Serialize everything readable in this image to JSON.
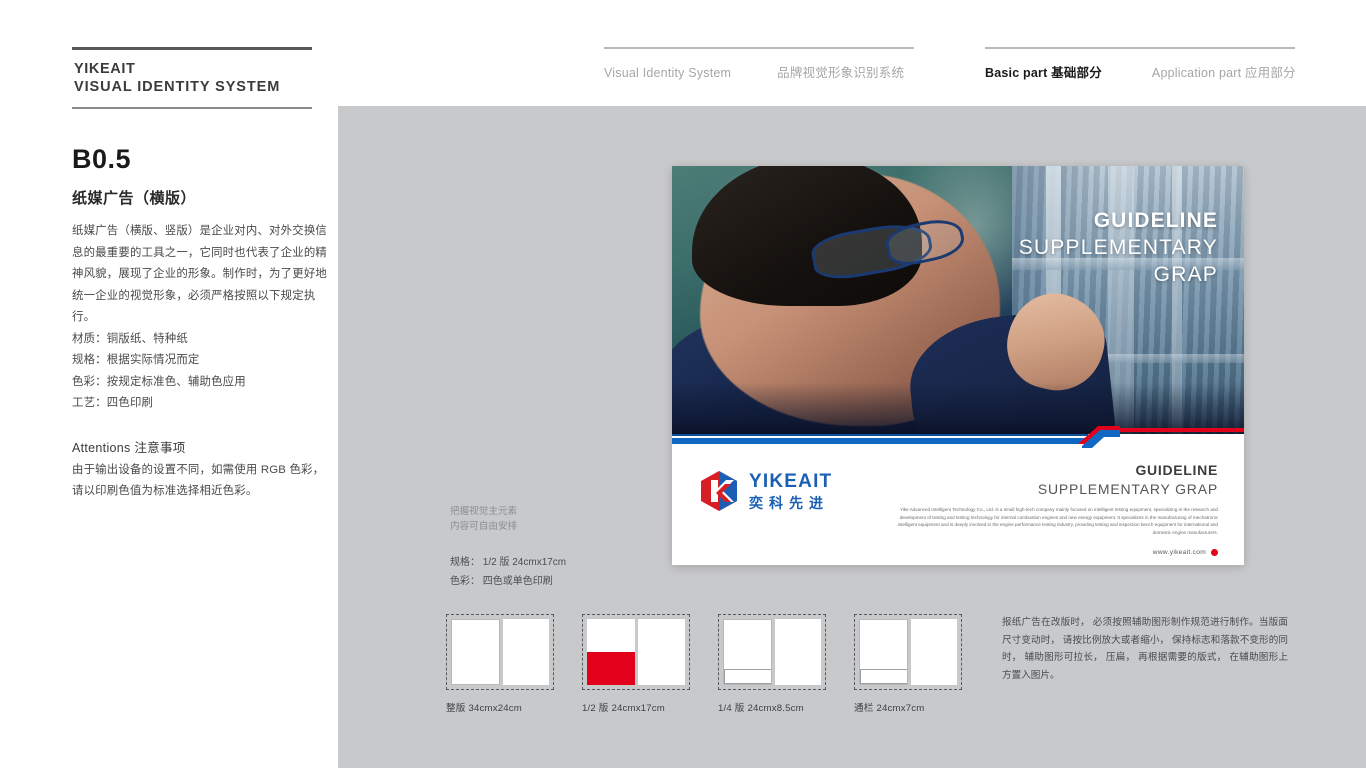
{
  "header": {
    "brand_line1": "YIKEAIT",
    "brand_line2": "VISUAL IDENTITY SYSTEM",
    "nav_group_1": [
      {
        "label": "Visual Identity System",
        "active": false
      },
      {
        "label": "品牌视觉形象识别系统",
        "active": false
      }
    ],
    "nav_group_2": [
      {
        "label": "Basic part 基础部分",
        "active": true
      },
      {
        "label": "Application part 应用部分",
        "active": false
      }
    ]
  },
  "left": {
    "section_code": "B0.5",
    "section_title": "纸媒广告（横版）",
    "description": "纸媒广告（横版、竖版）是企业对内、对外交换信息的最重要的工具之一，它同时也代表了企业的精神风貌，展现了企业的形象。制作时，为了更好地统一企业的视觉形象，必须严格按照以下规定执行。",
    "specs": [
      "材质：铜版纸、特种纸",
      "规格：根据实际情况而定",
      "色彩：按规定标准色、辅助色应用",
      "工艺：四色印刷"
    ],
    "attentions_heading": "Attentions 注意事项",
    "attentions_body": "由于输出设备的设置不同，如需使用 RGB 色彩，请以印刷色值为标准选择相近色彩。"
  },
  "poster": {
    "headline_1": "GUIDELINE",
    "headline_2": "SUPPLEMENTARY",
    "headline_3": "GRAP",
    "logo_en": "YIKEAIT",
    "logo_cn": "奕科先进",
    "right_title_1": "GUIDELINE",
    "right_title_2": "SUPPLEMENTARY GRAP",
    "right_paragraph": "Yike Advanced Intelligent Technology Co., Ltd. is a small high-tech company mainly focused on intelligent testing equipment, specializing in the research and development of testing and testing technology for internal combustion engines and new energy equipment. It specializes in the manufacturing of mechatronic intelligent equipment and is deeply involved in the engine performance testing industry, providing testing and inspection bench equipment for international and domestic engine manufacturers.",
    "url": "www.yikeait.com"
  },
  "stage": {
    "note_line_1": "把握视觉主元素",
    "note_line_2": "内容可自由安排",
    "spec_line_1": "规格： 1/2 版 24cmx17cm",
    "spec_line_2": "色彩： 四色或单色印刷",
    "thumbnails": [
      {
        "caption": "整版 34cmx24cm",
        "variant": "full"
      },
      {
        "caption": "1/2 版 24cmx17cm",
        "variant": "half-red"
      },
      {
        "caption": "1/4 版 24cmx8.5cm",
        "variant": "quarter"
      },
      {
        "caption": "通栏 24cmx7cm",
        "variant": "banner"
      }
    ],
    "side_paragraph": "报纸广告在改版时， 必须按照辅助图形制作规范进行制作。当版面尺寸变动时， 请按比例放大或者缩小， 保持标志和落款不变形的同时， 辅助图形可拉长， 压扁， 再根据需要的版式， 在辅助图形上方置入图片。"
  },
  "colors": {
    "brand_blue": "#1a5fb4",
    "brand_red": "#e2001a",
    "stage_gray": "#c8c9cb",
    "bar_blue": "#1168c4"
  }
}
